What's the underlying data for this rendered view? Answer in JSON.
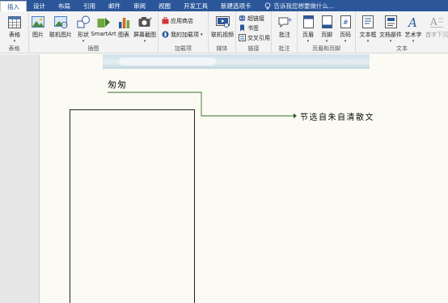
{
  "tabs": [
    {
      "label": "插入",
      "active": true
    },
    {
      "label": "设计"
    },
    {
      "label": "布局"
    },
    {
      "label": "引用"
    },
    {
      "label": "邮件"
    },
    {
      "label": "审阅"
    },
    {
      "label": "视图"
    },
    {
      "label": "开发工具"
    },
    {
      "label": "新建选项卡"
    }
  ],
  "tell_me": "告诉我您想要做什么...",
  "ribbon": {
    "groups": {
      "tables": "表格",
      "illustrations": "插图",
      "addins": "加载项",
      "media": "媒体",
      "links": "链接",
      "comments": "批注",
      "header_footer": "页眉和页脚",
      "text": "文本"
    },
    "buttons": {
      "table": "表格",
      "picture": "图片",
      "online_picture": "联机图片",
      "shapes": "形状",
      "smartart": "SmartArt",
      "chart": "图表",
      "screenshot": "屏幕截图",
      "store": "应用商店",
      "my_addins": "我的加载项",
      "online_video": "联机视频",
      "hyperlink": "超链接",
      "bookmark": "书签",
      "cross_ref": "交叉引用",
      "comment": "批注",
      "header": "页眉",
      "footer": "页脚",
      "page_number": "页码",
      "textbox": "文本框",
      "quick_parts": "文档部件",
      "wordart": "艺术字",
      "dropcap": "首字下沉"
    }
  },
  "document": {
    "title": "匆匆",
    "callout": "节选自朱自清散文"
  },
  "colors": {
    "tabbar": "#2b579a",
    "connector": "#3a6e2e"
  }
}
